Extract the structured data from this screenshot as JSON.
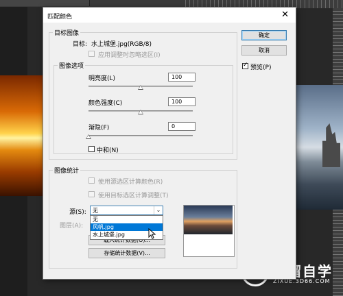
{
  "window": {
    "title": "匹配颜色",
    "close_glyph": "✕"
  },
  "target_group": {
    "legend": "目标图像",
    "target_label": "目标:",
    "target_value": "水上城堡.jpg(RGB/8)",
    "ignore_selection": "应用调整时忽略选区(I)"
  },
  "options_group": {
    "legend": "图像选项",
    "luminance_label": "明亮度(L)",
    "luminance_value": "100",
    "luminance_level": 0.5,
    "color_intensity_label": "颜色强度(C)",
    "color_intensity_value": "100",
    "color_intensity_level": 0.5,
    "fade_label": "渐隐(F)",
    "fade_value": "0",
    "fade_level": 0,
    "neutralize_label": "中和(N)"
  },
  "stats_group": {
    "legend": "图像统计",
    "use_source_selection": "使用源选区计算颜色(R)",
    "use_target_selection": "使用目标选区计算调整(T)",
    "source_label": "源(S):",
    "source_value": "无",
    "source_options": [
      "无",
      "风帆.jpg",
      "水上城堡.jpg"
    ],
    "layer_label": "图层(A):",
    "load_stats_partial": "载入统计数据(O)...",
    "save_stats": "存储统计数据(V)..."
  },
  "buttons": {
    "ok": "确定",
    "cancel": "取消",
    "preview_label": "预览(P)"
  },
  "watermark": {
    "title": "溜溜自学",
    "subtitle": "ZIXUE.3D66.COM"
  },
  "colors": {
    "accent": "#0078d7",
    "dialog_bg": "#f0f0f0",
    "workspace": "#282828"
  }
}
